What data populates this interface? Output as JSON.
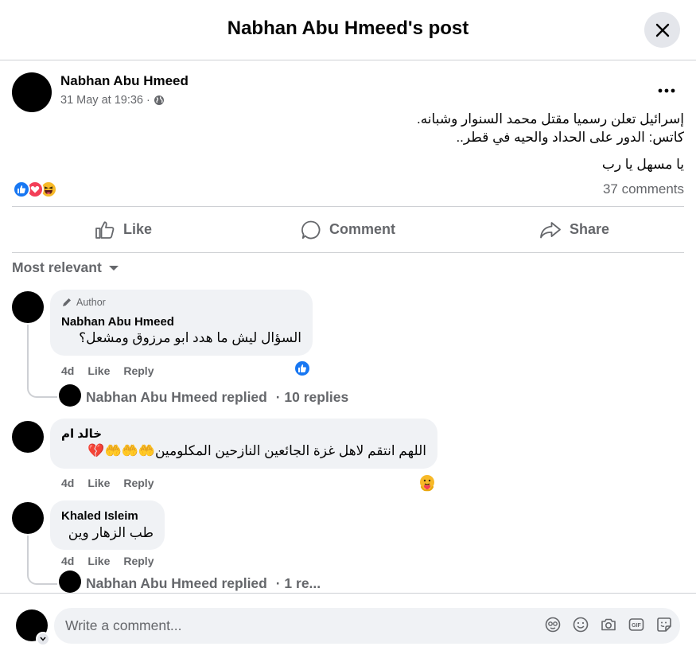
{
  "header": {
    "title": "Nabhan Abu Hmeed's post"
  },
  "post": {
    "author": "Nabhan Abu Hmeed",
    "timestamp": "31 May at 19:36",
    "separator": "·",
    "text_line1": "إسرائيل تعلن رسميا مقتل محمد السنوار وشبانه.",
    "text_line2": "كاتس: الدور على الحداد والحيه في قطر..",
    "text_line3": "يا مسهل يا رب",
    "reaction_icons": [
      "like-icon",
      "love-icon",
      "haha-icon"
    ],
    "comments_count": "37 comments"
  },
  "actions": {
    "like": "Like",
    "comment": "Comment",
    "share": "Share"
  },
  "sort_label": "Most relevant",
  "comments": [
    {
      "badge": "Author",
      "name": "Nabhan Abu Hmeed",
      "text": "السؤال ليش ما هدد ابو مرزوق ومشعل؟",
      "time": "4d",
      "like": "Like",
      "reply": "Reply",
      "reaction": "like-icon",
      "replied": "Nabhan Abu Hmeed replied",
      "replies": "· 10 replies"
    },
    {
      "name": "خالد ام",
      "text": "اللهم انتقم لاهل غزة الجائعين النازحين المكلومين🤲🤲🤲💔",
      "time": "4d",
      "like": "Like",
      "reply": "Reply",
      "reaction": "care-icon"
    },
    {
      "name": "Khaled Isleim",
      "text": "طب الزهار وين",
      "time": "4d",
      "like": "Like",
      "reply": "Reply",
      "replied": "Nabhan Abu Hmeed replied",
      "replies": "· 1 re..."
    }
  ],
  "composer": {
    "placeholder": "Write a comment..."
  },
  "colors": {
    "accent": "#1877f2",
    "love": "#f33e58",
    "text_secondary": "#65676b",
    "bubble": "#f0f2f5"
  }
}
